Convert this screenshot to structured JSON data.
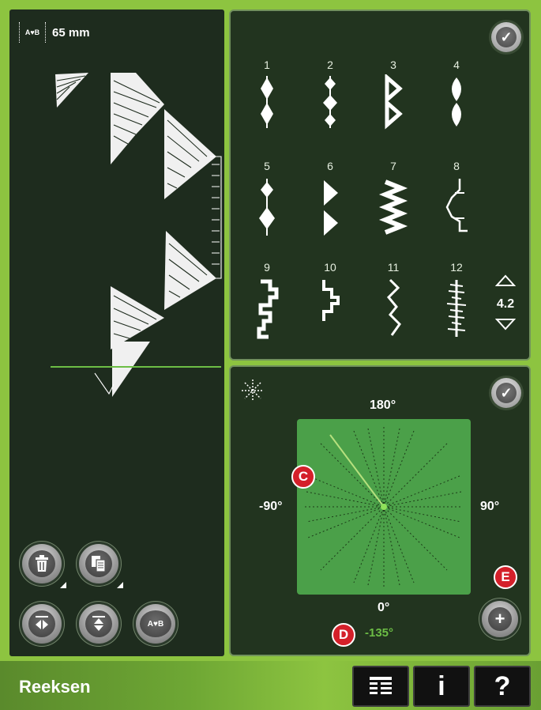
{
  "preview": {
    "width_icon_label": "A♥B",
    "width_value": "65 mm"
  },
  "stitch_menu": {
    "confirm_icon": "checkmark-icon",
    "stitches": [
      {
        "num": "1"
      },
      {
        "num": "2"
      },
      {
        "num": "3"
      },
      {
        "num": "4"
      },
      {
        "num": "5"
      },
      {
        "num": "6"
      },
      {
        "num": "7"
      },
      {
        "num": "8"
      },
      {
        "num": "9"
      },
      {
        "num": "10"
      },
      {
        "num": "11"
      },
      {
        "num": "12"
      }
    ],
    "page": "4.2"
  },
  "angle_control": {
    "label_top": "180°",
    "label_left": "-90°",
    "label_right": "90°",
    "label_bottom": "0°",
    "selected_angle": "-135°",
    "accent_color": "#6cbd45"
  },
  "markers": {
    "c": "C",
    "d": "D",
    "e": "E"
  },
  "toolbar_left": {
    "delete_icon": "trash-icon",
    "copy_icon": "copy-icon",
    "mirror_side_icon": "mirror-side-to-side-icon",
    "mirror_end_icon": "mirror-end-to-end-icon",
    "text_button_label": "A♥B"
  },
  "bottom_bar": {
    "title": "Reeksen",
    "menu_icon": "list-icon",
    "info_label": "i",
    "help_label": "?"
  }
}
